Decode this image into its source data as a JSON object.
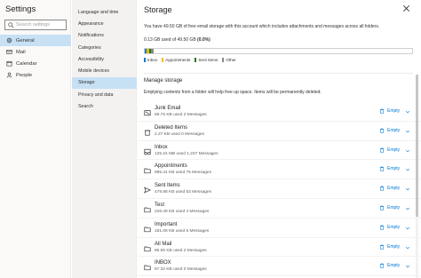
{
  "left": {
    "title": "Settings",
    "search_placeholder": "Search settings",
    "items": [
      {
        "label": "General",
        "icon": "gear-icon",
        "active": true
      },
      {
        "label": "Mail",
        "icon": "mail-icon",
        "active": false
      },
      {
        "label": "Calendar",
        "icon": "calendar-icon",
        "active": false
      },
      {
        "label": "People",
        "icon": "people-icon",
        "active": false
      }
    ]
  },
  "middle": {
    "items": [
      {
        "label": "Language and time",
        "active": false
      },
      {
        "label": "Appearance",
        "active": false
      },
      {
        "label": "Notifications",
        "active": false
      },
      {
        "label": "Categories",
        "active": false
      },
      {
        "label": "Accessibility",
        "active": false
      },
      {
        "label": "Mobile devices",
        "active": false
      },
      {
        "label": "Storage",
        "active": true
      },
      {
        "label": "Privacy and data",
        "active": false
      },
      {
        "label": "Search",
        "active": false
      }
    ]
  },
  "content": {
    "title": "Storage",
    "description": "You have 49.50 GB of free email storage with this account which includes attachments and messages across all folders.",
    "usage_prefix": "0.13 GB used of 49.50 GB",
    "usage_percent": "(0.0%)",
    "bar_segments": [
      {
        "name": "Inbox",
        "color": "#0078d4",
        "fraction": 0.008
      },
      {
        "name": "Appointments",
        "color": "#ffb900",
        "fraction": 0.008
      },
      {
        "name": "Sent Items",
        "color": "#107c10",
        "fraction": 0.008
      },
      {
        "name": "Other",
        "color": "#8a8886",
        "fraction": 0.008
      }
    ],
    "legend": [
      {
        "label": "Inbox",
        "color": "#0078d4"
      },
      {
        "label": "Appointments",
        "color": "#ffb900"
      },
      {
        "label": "Sent Items",
        "color": "#107c10"
      },
      {
        "label": "Other",
        "color": "#8a8886"
      }
    ],
    "manage_title": "Manage storage",
    "manage_description": "Emptying contents from a folder will help free up space. Items will be permanently deleted.",
    "empty_label": "Empty",
    "folders": [
      {
        "name": "Junk Email",
        "meta": "69.75 KB used   2 Messages",
        "icon": "junk-icon"
      },
      {
        "name": "Deleted Items",
        "meta": "2.27 KB used   0 Messages",
        "icon": "trash-icon"
      },
      {
        "name": "Inbox",
        "meta": "125.24 MB used   1,237 Messages",
        "icon": "inbox-icon"
      },
      {
        "name": "Appointments",
        "meta": "995.41 KB used   75 Messages",
        "icon": "folder-icon"
      },
      {
        "name": "Sent Items",
        "meta": "479.88 KB used   53 Messages",
        "icon": "send-icon"
      },
      {
        "name": "Test",
        "meta": "226.49 KB used   4 Messages",
        "icon": "folder-icon"
      },
      {
        "name": "Important",
        "meta": "181.08 KB used   5 Messages",
        "icon": "folder-icon"
      },
      {
        "name": "All Mail",
        "meta": "85.65 KB used   2 Messages",
        "icon": "folder-icon"
      },
      {
        "name": "INBOX",
        "meta": "67.32 KB used   0 Messages",
        "icon": "folder-icon"
      }
    ]
  },
  "colors": {
    "accent": "#0078d4",
    "selected_bg": "#c7e0f4"
  }
}
